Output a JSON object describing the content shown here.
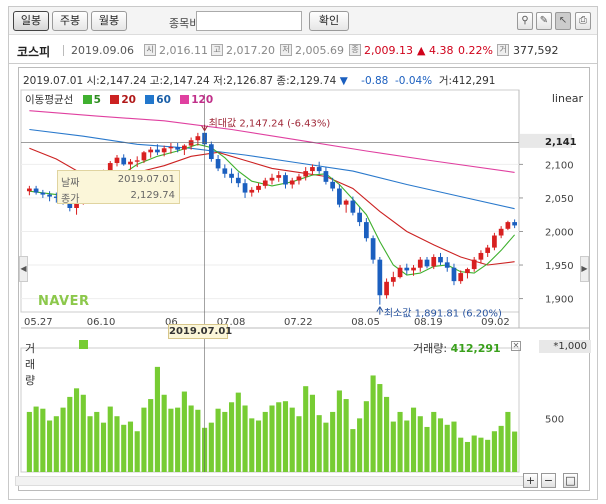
{
  "toolbar": {
    "tabs": [
      "일봉",
      "주봉",
      "월봉"
    ],
    "compare_label": "종목비교",
    "confirm": "확인"
  },
  "quote": {
    "name": "코스피",
    "date": "2019.09.06",
    "open_label": "시",
    "open": "2,016.11",
    "high_label": "고",
    "high": "2,017.20",
    "low_label": "저",
    "low": "2,005.69",
    "close_label": "종",
    "close": "2,009.13",
    "change": "▲ 4.38",
    "change_pct": "0.22%",
    "volume_label": "거",
    "volume": "377,592"
  },
  "info": {
    "date": "2019.07.01",
    "o_label": "시:",
    "o": "2,147.24",
    "h_label": "고:",
    "h": "2,147.24",
    "l_label": "저:",
    "l": "2,126.87",
    "c_label": "종:",
    "c": "2,129.74",
    "arrow": "▼",
    "chg": "-0.88",
    "pct": "-0.04%",
    "v_label": "거:",
    "v": "412,291"
  },
  "ma": {
    "label": "이동평균선",
    "items": [
      {
        "name": "5",
        "color": "#40b030"
      },
      {
        "name": "20",
        "color": "#cc2222"
      },
      {
        "name": "60",
        "color": "#2277cc"
      },
      {
        "name": "120",
        "color": "#e040a0"
      }
    ]
  },
  "scale_label": "linear",
  "tooltip": {
    "date_label": "날짜",
    "date": "2019.07.01",
    "close_label": "종가",
    "close": "2,129.74"
  },
  "annotations": {
    "max": "최대값 2,147.24 (-6.43%)",
    "min": "최소값 1,891.81 (6.20%)"
  },
  "logo": "NAVER",
  "current_price_tag": "2,141",
  "date_highlight": "2019.07.01",
  "volume": {
    "label": "거래량",
    "value_label": "거래량:",
    "value": "412,291",
    "axis_unit": "*1,000",
    "color": "#77cc33"
  },
  "colors": {
    "up": "#d82020",
    "down": "#1b5fbf",
    "volume": "#77cc33",
    "max_line": "#a02a3a",
    "min_line": "#2a55a0"
  },
  "chart_data": {
    "type": "candlestick",
    "title": "",
    "ylim": [
      1880,
      2190
    ],
    "y_ticks": [
      1900,
      1950,
      2000,
      2050,
      2100
    ],
    "y_tick_labels": [
      "1,900",
      "1,950",
      "2,000",
      "2,050",
      "2,100"
    ],
    "x_tick_labels": [
      "05.27",
      "06.10",
      "06",
      "07.08",
      "07.22",
      "08.05",
      "08.19",
      "09.02"
    ],
    "vol_ylim": [
      0,
      1100
    ],
    "vol_ticks": [
      500,
      1000
    ],
    "vol_tick_labels": [
      "500",
      "1,000"
    ],
    "candles": [
      [
        2060,
        2068,
        2054,
        2064,
        560
      ],
      [
        2064,
        2068,
        2055,
        2058,
        610
      ],
      [
        2058,
        2062,
        2050,
        2055,
        590
      ],
      [
        2055,
        2060,
        2045,
        2052,
        480
      ],
      [
        2052,
        2058,
        2043,
        2050,
        520
      ],
      [
        2050,
        2055,
        2040,
        2045,
        600
      ],
      [
        2045,
        2052,
        2030,
        2035,
        700
      ],
      [
        2035,
        2048,
        2025,
        2046,
        780
      ],
      [
        2046,
        2058,
        2040,
        2055,
        720
      ],
      [
        2055,
        2070,
        2050,
        2066,
        520
      ],
      [
        2066,
        2080,
        2062,
        2078,
        560
      ],
      [
        2078,
        2092,
        2074,
        2090,
        460
      ],
      [
        2090,
        2105,
        2086,
        2102,
        610
      ],
      [
        2102,
        2114,
        2097,
        2110,
        520
      ],
      [
        2110,
        2115,
        2098,
        2100,
        440
      ],
      [
        2100,
        2108,
        2092,
        2104,
        470
      ],
      [
        2104,
        2112,
        2096,
        2106,
        380
      ],
      [
        2106,
        2120,
        2102,
        2118,
        600
      ],
      [
        2118,
        2126,
        2110,
        2122,
        680
      ],
      [
        2122,
        2130,
        2114,
        2118,
        980
      ],
      [
        2118,
        2128,
        2112,
        2124,
        720
      ],
      [
        2124,
        2132,
        2116,
        2126,
        590
      ],
      [
        2126,
        2132,
        2118,
        2122,
        600
      ],
      [
        2122,
        2130,
        2114,
        2128,
        750
      ],
      [
        2128,
        2140,
        2122,
        2136,
        620
      ],
      [
        2136,
        2147,
        2128,
        2142,
        580
      ],
      [
        2147,
        2147,
        2127,
        2130,
        412
      ],
      [
        2130,
        2134,
        2104,
        2108,
        460
      ],
      [
        2108,
        2114,
        2090,
        2094,
        590
      ],
      [
        2094,
        2100,
        2080,
        2086,
        560
      ],
      [
        2086,
        2094,
        2072,
        2080,
        650
      ],
      [
        2080,
        2088,
        2066,
        2072,
        740
      ],
      [
        2072,
        2078,
        2050,
        2058,
        620
      ],
      [
        2058,
        2066,
        2052,
        2062,
        500
      ],
      [
        2062,
        2072,
        2058,
        2068,
        480
      ],
      [
        2068,
        2080,
        2064,
        2076,
        560
      ],
      [
        2076,
        2086,
        2070,
        2080,
        620
      ],
      [
        2080,
        2090,
        2074,
        2084,
        650
      ],
      [
        2084,
        2088,
        2064,
        2070,
        660
      ],
      [
        2070,
        2080,
        2064,
        2076,
        600
      ],
      [
        2076,
        2086,
        2070,
        2082,
        520
      ],
      [
        2082,
        2096,
        2076,
        2090,
        800
      ],
      [
        2090,
        2100,
        2084,
        2096,
        720
      ],
      [
        2096,
        2104,
        2086,
        2090,
        530
      ],
      [
        2090,
        2096,
        2070,
        2074,
        460
      ],
      [
        2074,
        2080,
        2060,
        2064,
        560
      ],
      [
        2064,
        2070,
        2036,
        2040,
        760
      ],
      [
        2040,
        2048,
        2028,
        2046,
        680
      ],
      [
        2046,
        2052,
        2024,
        2028,
        400
      ],
      [
        2028,
        2036,
        2008,
        2014,
        500
      ],
      [
        2014,
        2020,
        1985,
        1990,
        660
      ],
      [
        1990,
        1994,
        1952,
        1958,
        900
      ],
      [
        1958,
        1962,
        1891,
        1905,
        820
      ],
      [
        1905,
        1930,
        1900,
        1925,
        700
      ],
      [
        1925,
        1940,
        1918,
        1932,
        470
      ],
      [
        1932,
        1950,
        1930,
        1946,
        560
      ],
      [
        1946,
        1952,
        1936,
        1942,
        480
      ],
      [
        1942,
        1950,
        1934,
        1946,
        600
      ],
      [
        1946,
        1962,
        1940,
        1958,
        520
      ],
      [
        1958,
        1962,
        1945,
        1948,
        420
      ],
      [
        1948,
        1966,
        1944,
        1962,
        560
      ],
      [
        1962,
        1968,
        1950,
        1954,
        500
      ],
      [
        1954,
        1962,
        1940,
        1946,
        440
      ],
      [
        1946,
        1952,
        1920,
        1926,
        470
      ],
      [
        1926,
        1942,
        1922,
        1938,
        320
      ],
      [
        1938,
        1946,
        1930,
        1944,
        280
      ],
      [
        1944,
        1962,
        1940,
        1958,
        340
      ],
      [
        1958,
        1972,
        1952,
        1968,
        320
      ],
      [
        1968,
        1980,
        1962,
        1976,
        300
      ],
      [
        1976,
        1998,
        1972,
        1994,
        380
      ],
      [
        1994,
        2008,
        1990,
        2004,
        430
      ],
      [
        2004,
        2016,
        2002,
        2014,
        560
      ],
      [
        2014,
        2018,
        2005,
        2009,
        377
      ]
    ],
    "ma5": [
      [
        0,
        2060
      ],
      [
        4,
        2055
      ],
      [
        7,
        2048
      ],
      [
        10,
        2058
      ],
      [
        13,
        2080
      ],
      [
        16,
        2100
      ],
      [
        19,
        2112
      ],
      [
        22,
        2120
      ],
      [
        25,
        2130
      ],
      [
        27,
        2125
      ],
      [
        29,
        2110
      ],
      [
        31,
        2090
      ],
      [
        33,
        2075
      ],
      [
        36,
        2068
      ],
      [
        39,
        2074
      ],
      [
        42,
        2084
      ],
      [
        44,
        2086
      ],
      [
        46,
        2070
      ],
      [
        48,
        2048
      ],
      [
        50,
        2025
      ],
      [
        52,
        1985
      ],
      [
        54,
        1950
      ],
      [
        56,
        1935
      ],
      [
        58,
        1938
      ],
      [
        60,
        1948
      ],
      [
        62,
        1950
      ],
      [
        64,
        1940
      ],
      [
        66,
        1938
      ],
      [
        68,
        1952
      ],
      [
        70,
        1972
      ],
      [
        72,
        1995
      ]
    ],
    "ma20": [
      [
        0,
        2124
      ],
      [
        4,
        2108
      ],
      [
        8,
        2085
      ],
      [
        12,
        2080
      ],
      [
        16,
        2088
      ],
      [
        20,
        2098
      ],
      [
        24,
        2112
      ],
      [
        28,
        2118
      ],
      [
        32,
        2106
      ],
      [
        36,
        2094
      ],
      [
        40,
        2088
      ],
      [
        44,
        2082
      ],
      [
        48,
        2064
      ],
      [
        52,
        2030
      ],
      [
        56,
        2000
      ],
      [
        60,
        1980
      ],
      [
        64,
        1962
      ],
      [
        68,
        1950
      ],
      [
        72,
        1955
      ]
    ],
    "ma60": [
      [
        0,
        2152
      ],
      [
        8,
        2142
      ],
      [
        16,
        2130
      ],
      [
        24,
        2124
      ],
      [
        32,
        2114
      ],
      [
        40,
        2102
      ],
      [
        48,
        2090
      ],
      [
        56,
        2070
      ],
      [
        64,
        2052
      ],
      [
        72,
        2034
      ]
    ],
    "ma120": [
      [
        0,
        2180
      ],
      [
        10,
        2172
      ],
      [
        20,
        2165
      ],
      [
        30,
        2152
      ],
      [
        40,
        2136
      ],
      [
        50,
        2120
      ],
      [
        60,
        2105
      ],
      [
        72,
        2088
      ]
    ]
  }
}
